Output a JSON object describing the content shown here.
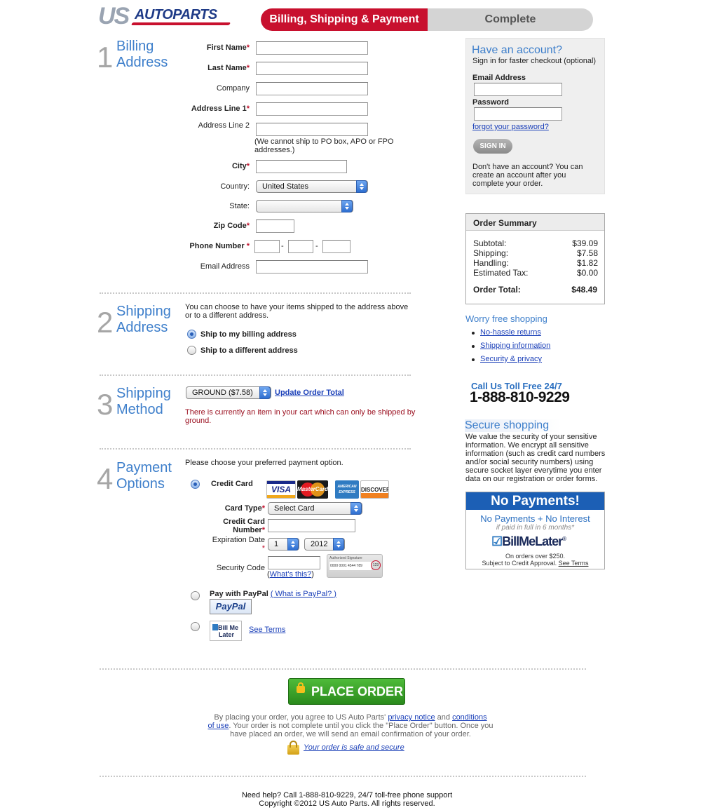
{
  "header": {
    "logo_us": "US",
    "logo_autoparts": "AUTOPARTS",
    "step_active": "Billing, Shipping & Payment",
    "step_inactive": "Complete"
  },
  "billing": {
    "num": "1",
    "title_line1": "Billing",
    "title_line2": "Address",
    "first_name_label": "First Name",
    "last_name_label": "Last Name",
    "company_label": "Company",
    "address1_label": "Address Line 1",
    "address2_label": "Address Line 2",
    "po_note": "(We cannot ship to PO box, APO or FPO addresses.)",
    "city_label": "City",
    "country_label": "Country:",
    "country_value": "United States",
    "state_label": "State:",
    "zip_label": "Zip Code",
    "phone_label": "Phone Number",
    "phone_sep": "-",
    "email_label": "Email Address",
    "required_mark": "*"
  },
  "shipping_address": {
    "num": "2",
    "title_line1": "Shipping",
    "title_line2": "Address",
    "intro": "You can choose to have your items shipped to the address above or to a different address.",
    "option_billing": "Ship to my billing address",
    "option_different": "Ship to a different address"
  },
  "shipping_method": {
    "num": "3",
    "title_line1": "Shipping",
    "title_line2": "Method",
    "selected": "GROUND ($7.58)",
    "update_link": "Update Order Total",
    "warning": "There is currently an item in your cart which can only be shipped by ground."
  },
  "payment": {
    "num": "4",
    "title_line1": "Payment",
    "title_line2": "Options",
    "intro": "Please choose your preferred payment option.",
    "credit_card_label": "Credit Card",
    "cards": [
      "VISA",
      "MasterCard",
      "AMERICAN EXPRESS",
      "DISCOVER"
    ],
    "card_type_label": "Card Type",
    "card_type_value": "Select Card",
    "cc_number_label_1": "Credit Card",
    "cc_number_label_2": "Number",
    "expiration_label": "Expiration Date",
    "exp_month": "1",
    "exp_year": "2012",
    "security_label": "Security Code",
    "whats_this": "What's this?",
    "whats_this_open": "(",
    "whats_this_close": ")",
    "cvv_img_text": "Authorized Signature",
    "cvv_img_number": "0000 0001 4544 789",
    "cvv_img_code": "123",
    "paypal_label": "Pay with PayPal",
    "paypal_link": "( What is PayPal? )",
    "paypal_logo": "PayPal",
    "bml_logo_1": "Bill Me",
    "bml_logo_2": "Later",
    "see_terms": "See Terms"
  },
  "place_order": {
    "button": "PLACE ORDER",
    "chevrons": "»",
    "agreement_1": "By placing your order, you agree to US Auto Parts'",
    "privacy_link": "privacy notice",
    "and": "and",
    "conditions_link_1": "conditions",
    "conditions_link_2": "of use",
    "agreement_2": ". Your order is not complete until you click the \"Place Order\" button. Once you have placed an order, we will send an email confirmation of your order.",
    "safe_link": "Your order is safe and secure"
  },
  "footer": {
    "help": "Need help? Call 1-888-810-9229, 24/7 toll-free phone support",
    "copyright": "Copyright ©2012 US Auto Parts. All rights reserved."
  },
  "account": {
    "title": "Have an account?",
    "subtitle": "Sign in for faster checkout (optional)",
    "email_label": "Email Address",
    "password_label": "Password",
    "forgot_link": "forgot your password?",
    "signin_button": "SIGN IN",
    "no_account": "Don't have an account? You can create an account after you complete your order."
  },
  "order_summary": {
    "title": "Order Summary",
    "rows": [
      {
        "label": "Subtotal:",
        "value": "$39.09"
      },
      {
        "label": "Shipping:",
        "value": "$7.58"
      },
      {
        "label": "Handling:",
        "value": "$1.82"
      },
      {
        "label": "Estimated Tax:",
        "value": "$0.00"
      }
    ],
    "total_label": "Order Total:",
    "total_value": "$48.49"
  },
  "worry_free": {
    "title": "Worry free shopping",
    "links": [
      "No-hassle returns",
      "Shipping information",
      "Security & privacy"
    ]
  },
  "call_us": {
    "title": "Call Us Toll Free 24/7",
    "phone": "1-888-810-9229"
  },
  "secure": {
    "title": "Secure shopping",
    "text": "We value the security of your sensitive information. We encrypt all sensitive information (such as credit card numbers and/or social security numbers) using secure socket layer everytime you enter data on our registration or order forms."
  },
  "bml_ad": {
    "banner": "No Payments!",
    "line1": "No Payments + No Interest",
    "line2": "if paid in full in 6 months*",
    "logo": "BillMeLater",
    "reg": "®",
    "note1": "On orders over $250.",
    "note2": "Subject to Credit Approval.",
    "terms_link": "See Terms"
  },
  "colors": {
    "brand_red": "#c8102e",
    "link_blue": "#1a3fb8",
    "heading_blue": "#3e7fcb",
    "place_order_green": "#2e8f1e"
  }
}
